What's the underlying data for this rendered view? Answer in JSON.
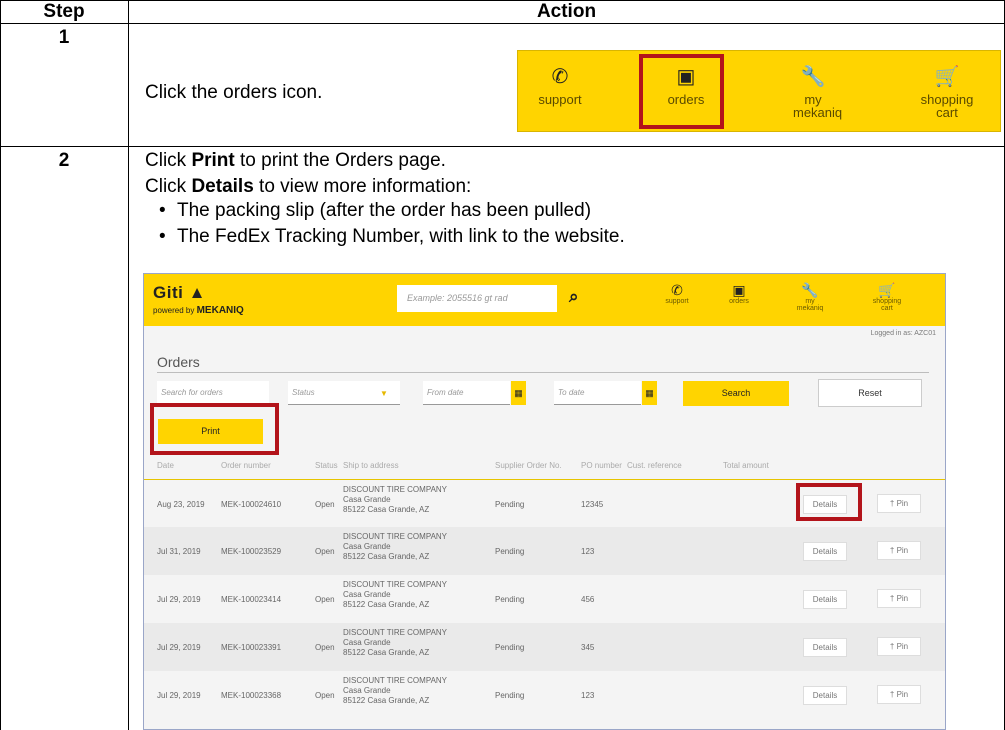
{
  "table": {
    "header_step": "Step",
    "header_action": "Action"
  },
  "step1": {
    "number": "1",
    "instruction": "Click the orders icon.",
    "nav": [
      {
        "label": "support",
        "icon": "phone-icon"
      },
      {
        "label": "orders",
        "icon": "orders-icon"
      },
      {
        "label": "my mekaniq",
        "icon": "wrench-icon"
      },
      {
        "label": "shopping cart",
        "icon": "cart-icon"
      }
    ]
  },
  "step2": {
    "number": "2",
    "line1_pre": "Click ",
    "line1_bold": "Print",
    "line1_post": " to print the Orders page.",
    "line2_pre": "Click ",
    "line2_bold": "Details",
    "line2_post": " to view more information:",
    "bullets": [
      "The packing slip (after the order has been pulled)",
      "The FedEx Tracking Number, with link to the website."
    ]
  },
  "app": {
    "logo": "Giti",
    "logo_sub_prefix": "powered by",
    "logo_sub_brand": "MEKANIQ",
    "search_placeholder": "Example: 2055516 gt rad",
    "nav": [
      {
        "label": "support",
        "icon": "phone-icon"
      },
      {
        "label": "orders",
        "icon": "orders-icon"
      },
      {
        "label": "my mekaniq",
        "icon": "wrench-icon"
      },
      {
        "label": "shopping cart",
        "icon": "cart-icon"
      }
    ],
    "logged_in": "Logged in as: AZC01",
    "page_title": "Orders",
    "filters": {
      "search_placeholder": "Search for orders",
      "status_placeholder": "Status",
      "from_date_placeholder": "From date",
      "to_date_placeholder": "To date",
      "search_button": "Search",
      "reset_button": "Reset"
    },
    "print_button": "Print",
    "columns": [
      "Date",
      "Order number",
      "Status",
      "Ship to address",
      "Supplier Order No.",
      "PO number",
      "Cust. reference",
      "Total amount"
    ],
    "details_label": "Details",
    "pin_label": "Pin",
    "orders": [
      {
        "date": "Aug 23, 2019",
        "order_number": "MEK-100024610",
        "status": "Open",
        "address_line1": "DISCOUNT TIRE COMPANY",
        "address_line2": "Casa Grande",
        "address_line3": "85122 Casa Grande, AZ",
        "supplier_order": "Pending",
        "po_number": "12345"
      },
      {
        "date": "Jul 31, 2019",
        "order_number": "MEK-100023529",
        "status": "Open",
        "address_line1": "DISCOUNT TIRE COMPANY",
        "address_line2": "Casa Grande",
        "address_line3": "85122 Casa Grande, AZ",
        "supplier_order": "Pending",
        "po_number": "123"
      },
      {
        "date": "Jul 29, 2019",
        "order_number": "MEK-100023414",
        "status": "Open",
        "address_line1": "DISCOUNT TIRE COMPANY",
        "address_line2": "Casa Grande",
        "address_line3": "85122 Casa Grande, AZ",
        "supplier_order": "Pending",
        "po_number": "456"
      },
      {
        "date": "Jul 29, 2019",
        "order_number": "MEK-100023391",
        "status": "Open",
        "address_line1": "DISCOUNT TIRE COMPANY",
        "address_line2": "Casa Grande",
        "address_line3": "85122 Casa Grande, AZ",
        "supplier_order": "Pending",
        "po_number": "345"
      },
      {
        "date": "Jul 29, 2019",
        "order_number": "MEK-100023368",
        "status": "Open",
        "address_line1": "DISCOUNT TIRE COMPANY",
        "address_line2": "Casa Grande",
        "address_line3": "85122 Casa Grande, AZ",
        "supplier_order": "Pending",
        "po_number": "123"
      }
    ]
  },
  "colors": {
    "brand_yellow": "#ffd400",
    "highlight_red": "#b3141b"
  }
}
